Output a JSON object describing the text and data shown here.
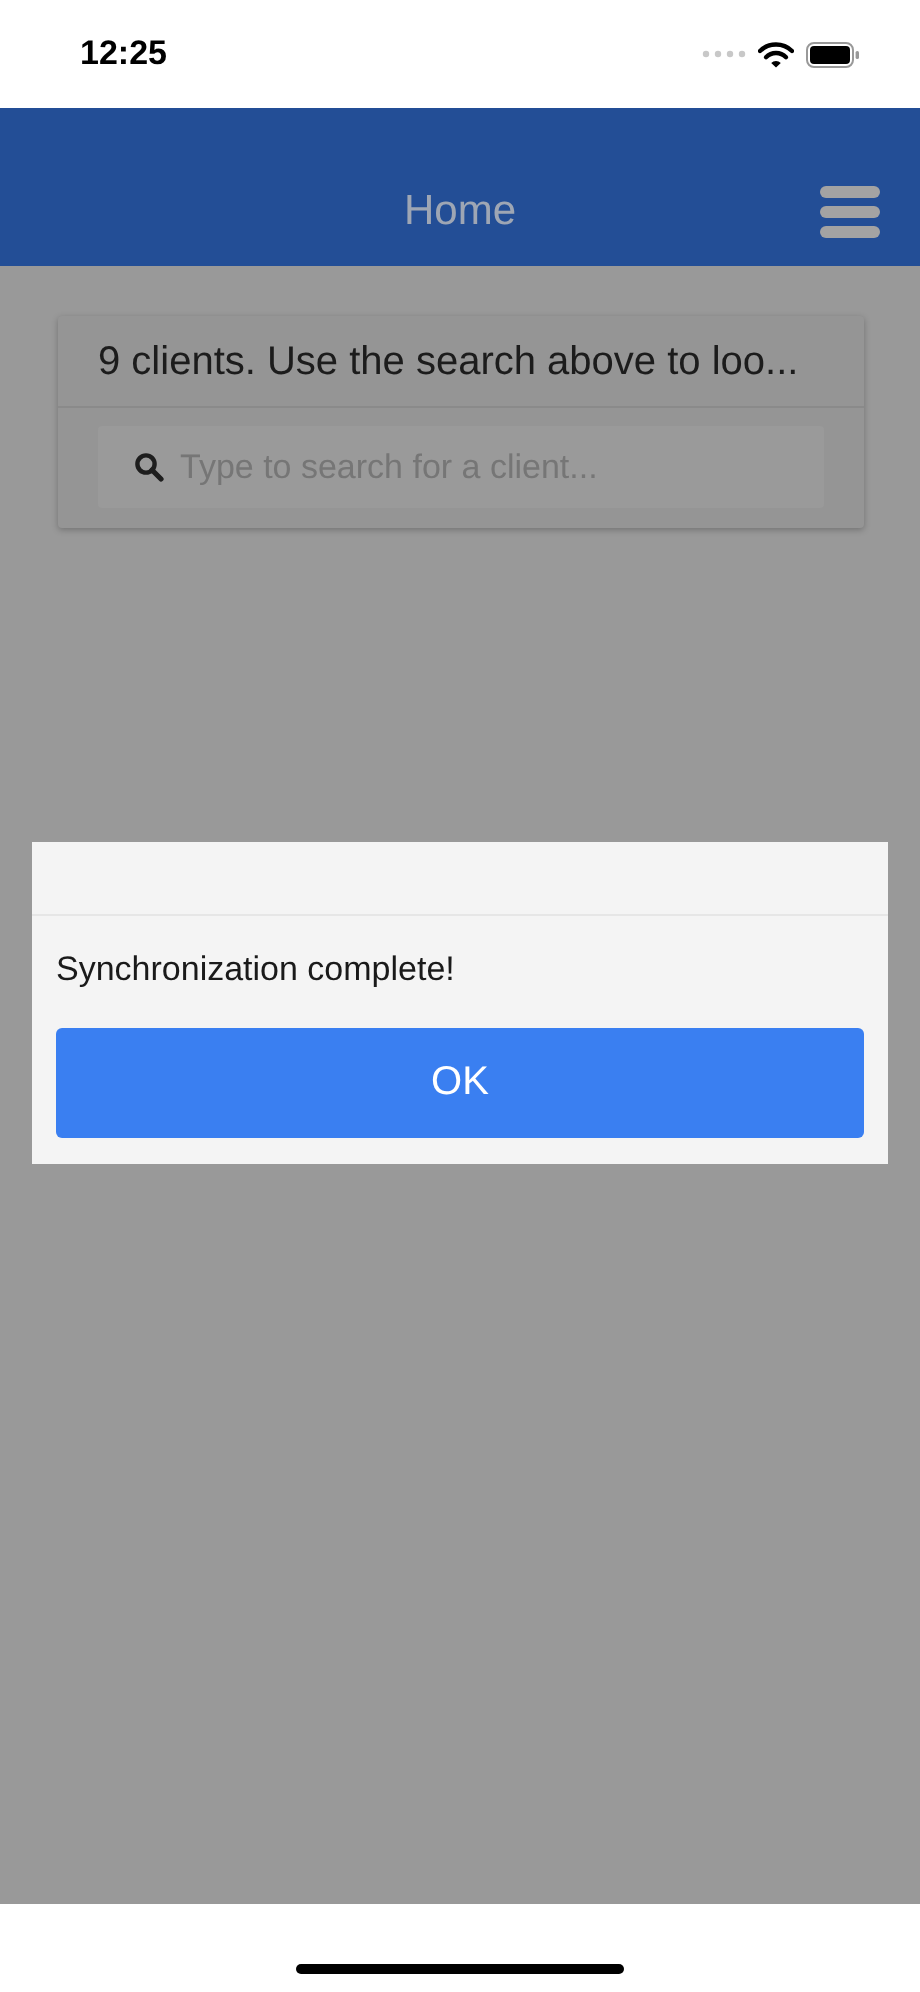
{
  "status_bar": {
    "time": "12:25"
  },
  "header": {
    "title": "Home"
  },
  "clients_card": {
    "summary": "9 clients. Use the search above to loo...",
    "search": {
      "placeholder": "Type to search for a client..."
    }
  },
  "dialog": {
    "message": "Synchronization complete!",
    "buttons": [
      "OK"
    ]
  }
}
